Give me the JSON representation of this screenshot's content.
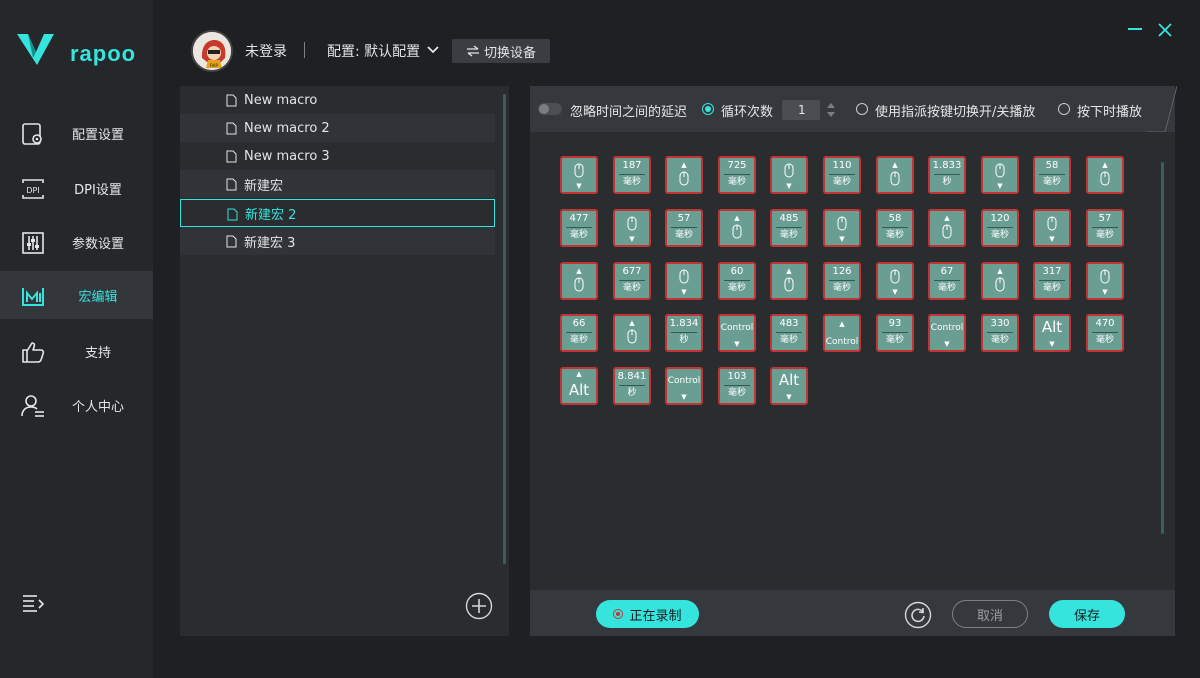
{
  "brand": {
    "name": "rapoo",
    "accent": "#35e4dd"
  },
  "sidebar": {
    "items": [
      {
        "label": "配置设置",
        "icon": "settings-file-icon"
      },
      {
        "label": "DPI设置",
        "icon": "dpi-icon"
      },
      {
        "label": "参数设置",
        "icon": "sliders-icon"
      },
      {
        "label": "宏编辑",
        "icon": "macro-icon",
        "active": true
      },
      {
        "label": "支持",
        "icon": "thumbs-up-icon"
      },
      {
        "label": "个人中心",
        "icon": "user-icon"
      }
    ]
  },
  "header": {
    "login_status": "未登录",
    "profile": "配置: 默认配置",
    "switch_device": "切换设备"
  },
  "macros": [
    {
      "name": "New macro"
    },
    {
      "name": "New macro 2"
    },
    {
      "name": "New macro 3"
    },
    {
      "name": "新建宏"
    },
    {
      "name": "新建宏 2",
      "selected": true
    },
    {
      "name": "新建宏 3"
    }
  ],
  "options": {
    "ignore_delay": "忽略时间之间的延迟",
    "loop_count_label": "循环次数",
    "loop_count_value": "1",
    "toggle_mode": "使用指派按键切换开/关播放",
    "hold_mode": "按下时播放"
  },
  "actions": [
    {
      "kind": "mouse",
      "dir": "down"
    },
    {
      "kind": "delay",
      "value": "187",
      "unit": "毫秒"
    },
    {
      "kind": "mouse",
      "dir": "up"
    },
    {
      "kind": "delay",
      "value": "725",
      "unit": "毫秒"
    },
    {
      "kind": "mouse",
      "dir": "down"
    },
    {
      "kind": "delay",
      "value": "110",
      "unit": "毫秒"
    },
    {
      "kind": "mouse",
      "dir": "up"
    },
    {
      "kind": "delay",
      "value": "1.833",
      "unit": "秒"
    },
    {
      "kind": "mouse",
      "dir": "down"
    },
    {
      "kind": "delay",
      "value": "58",
      "unit": "毫秒"
    },
    {
      "kind": "mouse",
      "dir": "up"
    },
    {
      "kind": "delay",
      "value": "477",
      "unit": "毫秒"
    },
    {
      "kind": "mouse",
      "dir": "down"
    },
    {
      "kind": "delay",
      "value": "57",
      "unit": "毫秒"
    },
    {
      "kind": "mouse",
      "dir": "up"
    },
    {
      "kind": "delay",
      "value": "485",
      "unit": "毫秒"
    },
    {
      "kind": "mouse",
      "dir": "down"
    },
    {
      "kind": "delay",
      "value": "58",
      "unit": "毫秒"
    },
    {
      "kind": "mouse",
      "dir": "up"
    },
    {
      "kind": "delay",
      "value": "120",
      "unit": "毫秒"
    },
    {
      "kind": "mouse",
      "dir": "down"
    },
    {
      "kind": "delay",
      "value": "57",
      "unit": "毫秒"
    },
    {
      "kind": "mouse",
      "dir": "up"
    },
    {
      "kind": "delay",
      "value": "677",
      "unit": "毫秒"
    },
    {
      "kind": "mouse",
      "dir": "down"
    },
    {
      "kind": "delay",
      "value": "60",
      "unit": "毫秒"
    },
    {
      "kind": "mouse",
      "dir": "up"
    },
    {
      "kind": "delay",
      "value": "126",
      "unit": "毫秒"
    },
    {
      "kind": "mouse",
      "dir": "down"
    },
    {
      "kind": "delay",
      "value": "67",
      "unit": "毫秒"
    },
    {
      "kind": "mouse",
      "dir": "up"
    },
    {
      "kind": "delay",
      "value": "317",
      "unit": "毫秒"
    },
    {
      "kind": "mouse",
      "dir": "down"
    },
    {
      "kind": "delay",
      "value": "66",
      "unit": "毫秒"
    },
    {
      "kind": "mouse",
      "dir": "up"
    },
    {
      "kind": "delay",
      "value": "1.834",
      "unit": "秒"
    },
    {
      "kind": "key",
      "key": "Control",
      "dir": "down"
    },
    {
      "kind": "delay",
      "value": "483",
      "unit": "毫秒"
    },
    {
      "kind": "key",
      "key": "Control",
      "dir": "up"
    },
    {
      "kind": "delay",
      "value": "93",
      "unit": "毫秒"
    },
    {
      "kind": "key",
      "key": "Control",
      "dir": "down"
    },
    {
      "kind": "delay",
      "value": "330",
      "unit": "毫秒"
    },
    {
      "kind": "alt",
      "key": "Alt",
      "dir": "down"
    },
    {
      "kind": "delay",
      "value": "470",
      "unit": "毫秒"
    },
    {
      "kind": "alt",
      "key": "Alt",
      "dir": "up"
    },
    {
      "kind": "delay",
      "value": "8.841",
      "unit": "秒"
    },
    {
      "kind": "key",
      "key": "Control",
      "dir": "down"
    },
    {
      "kind": "delay",
      "value": "103",
      "unit": "毫秒"
    },
    {
      "kind": "alt",
      "key": "Alt",
      "dir": "down"
    }
  ],
  "footer": {
    "recording": "正在录制",
    "cancel": "取消",
    "save": "保存"
  },
  "colors": {
    "tile_fill": "#6b9e93",
    "tile_border": "#c43434",
    "panel": "#2a2c30",
    "sidebar": "#25272b"
  }
}
